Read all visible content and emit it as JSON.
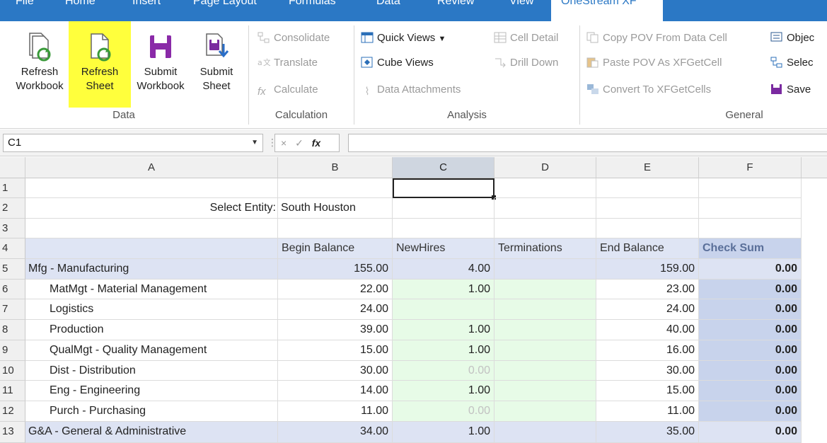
{
  "tabs": [
    "File",
    "Home",
    "Insert",
    "Page Layout",
    "Formulas",
    "Data",
    "Review",
    "View",
    "OneStream XF"
  ],
  "ribbon": {
    "data_group": {
      "label": "Data",
      "buttons": [
        {
          "label": "Refresh\nWorkbook",
          "icon": "refresh-workbook-icon"
        },
        {
          "label": "Refresh\nSheet",
          "icon": "refresh-sheet-icon"
        },
        {
          "label": "Submit\nWorkbook",
          "icon": "save-icon"
        },
        {
          "label": "Submit\nSheet",
          "icon": "submit-sheet-icon"
        }
      ]
    },
    "calculation_group": {
      "label": "Calculation",
      "items": [
        "Consolidate",
        "Translate",
        "Calculate"
      ]
    },
    "analysis_group": {
      "label": "Analysis",
      "items": [
        "Quick Views",
        "Cube Views",
        "Data Attachments",
        "Cell Detail",
        "Drill Down"
      ]
    },
    "general_group": {
      "label": "General",
      "items": [
        "Copy POV From Data Cell",
        "Paste POV As XFGetCell",
        "Convert To XFGetCells",
        "Objec",
        "Selec",
        "Save"
      ]
    }
  },
  "formula_bar": {
    "name_box": "C1",
    "cancel": "×",
    "enter": "✓",
    "fx": "fx",
    "value": ""
  },
  "columns": [
    "A",
    "B",
    "C",
    "D",
    "E",
    "F"
  ],
  "rows": [
    {
      "n": "1",
      "a": "",
      "b": "",
      "c": "",
      "d": "",
      "e": "",
      "f": ""
    },
    {
      "n": "2",
      "a": "Select Entity:",
      "b": "South Houston",
      "c": "",
      "d": "",
      "e": "",
      "f": ""
    },
    {
      "n": "3",
      "a": "",
      "b": "",
      "c": "",
      "d": "",
      "e": "",
      "f": ""
    },
    {
      "n": "4",
      "a": "",
      "b": "Begin Balance",
      "c": "NewHires",
      "d": "Terminations",
      "e": "End Balance",
      "f": "Check Sum"
    },
    {
      "n": "5",
      "a": "Mfg - Manufacturing",
      "b": "155.00",
      "c": "4.00",
      "d": "",
      "e": "159.00",
      "f": "0.00"
    },
    {
      "n": "6",
      "a": "MatMgt - Material Management",
      "b": "22.00",
      "c": "1.00",
      "d": "",
      "e": "23.00",
      "f": "0.00"
    },
    {
      "n": "7",
      "a": "Logistics",
      "b": "24.00",
      "c": "",
      "d": "",
      "e": "24.00",
      "f": "0.00"
    },
    {
      "n": "8",
      "a": "Production",
      "b": "39.00",
      "c": "1.00",
      "d": "",
      "e": "40.00",
      "f": "0.00"
    },
    {
      "n": "9",
      "a": "QualMgt - Quality Management",
      "b": "15.00",
      "c": "1.00",
      "d": "",
      "e": "16.00",
      "f": "0.00"
    },
    {
      "n": "10",
      "a": "Dist - Distribution",
      "b": "30.00",
      "c": "0.00",
      "d": "",
      "e": "30.00",
      "f": "0.00"
    },
    {
      "n": "11",
      "a": "Eng - Engineering",
      "b": "14.00",
      "c": "1.00",
      "d": "",
      "e": "15.00",
      "f": "0.00"
    },
    {
      "n": "12",
      "a": "Purch - Purchasing",
      "b": "11.00",
      "c": "0.00",
      "d": "",
      "e": "11.00",
      "f": "0.00"
    },
    {
      "n": "13",
      "a": "G&A - General & Administrative",
      "b": "34.00",
      "c": "1.00",
      "d": "",
      "e": "35.00",
      "f": "0.00"
    }
  ],
  "colors": {
    "tab_bar": "#2b78c5",
    "highlight": "#ffff3c",
    "parent_row": "#dde3f3",
    "header_row": "#dfe5f4",
    "input_green": "#e7fbe7",
    "check_col": "#c8d3ec"
  }
}
